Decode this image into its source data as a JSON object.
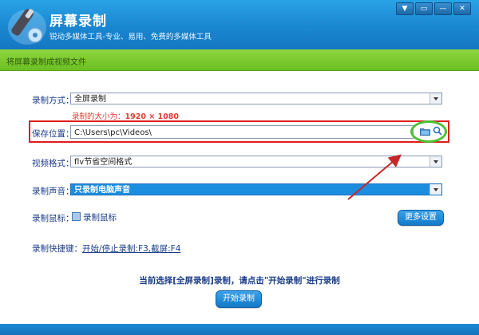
{
  "window": {
    "title": "屏幕录制",
    "subtitle": "锐动多媒体工具-专业、易用、免费的多媒体工具",
    "buttons": [
      "▼",
      "▭",
      "—",
      "✕"
    ]
  },
  "banner": {
    "text": "将屏幕录制成视频文件"
  },
  "form": {
    "record_mode": {
      "label": "录制方式：",
      "value": "全屏录制"
    },
    "size_hint": {
      "prefix": "录制的大小为：",
      "value": "1920 × 1080"
    },
    "save_location": {
      "label": "保存位置：",
      "value": "C:\\Users\\pc\\Videos\\"
    },
    "video_format": {
      "label": "视频格式：",
      "value": "flv节省空间格式"
    },
    "audio": {
      "label": "录制声音：",
      "value": "只录制电脑声音"
    },
    "mouse": {
      "label": "录制鼠标：",
      "checkbox_label": "录制鼠标",
      "checked": true
    },
    "more_settings_label": "更多设置",
    "hotkeys": {
      "label": "录制快捷键：",
      "value": "开始/停止录制:F3,截屏:F4"
    }
  },
  "status_message": "当前选择[全屏录制]录制，请点击\"开始录制\"进行录制",
  "start_button_label": "开始录制",
  "colors": {
    "titlebar": "#1a86d1",
    "banner": "#6cbf23",
    "annotation_red": "#e01c1c",
    "annotation_green": "#4cc235",
    "label_blue": "#1b3d8a"
  }
}
